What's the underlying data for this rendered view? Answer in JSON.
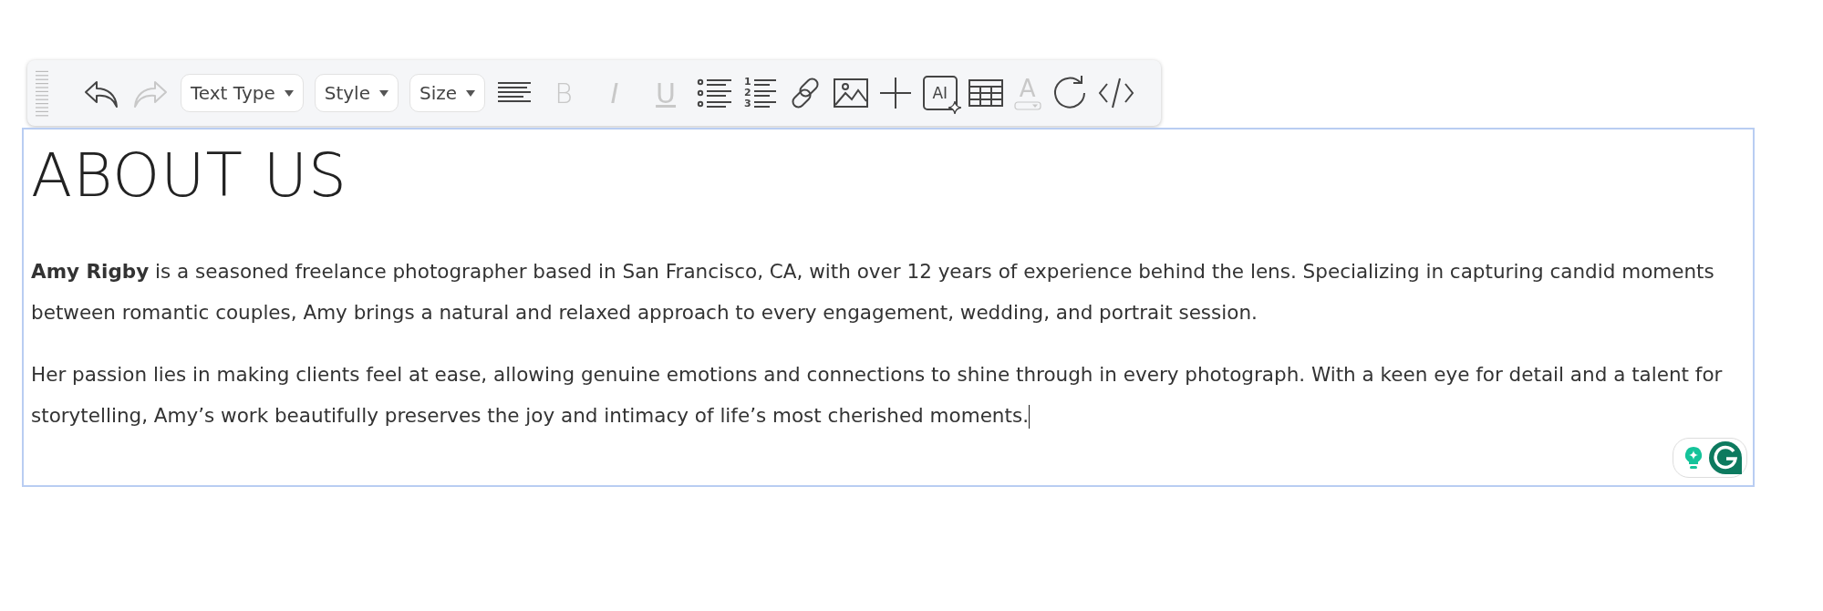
{
  "toolbar": {
    "undo": {
      "disabled": false
    },
    "redo": {
      "disabled": true
    },
    "dropdowns": [
      {
        "label": "Text Type"
      },
      {
        "label": "Style"
      },
      {
        "label": "Size"
      }
    ],
    "formats": [
      {
        "label": "B",
        "disabled": true
      },
      {
        "label": "I",
        "disabled": true
      },
      {
        "label": "U",
        "disabled": true
      }
    ],
    "numbered_list": {
      "marks": [
        "1",
        "2",
        "3"
      ]
    },
    "ai_button": {
      "label": "AI"
    },
    "text_color": {
      "label": "A",
      "disabled": true
    }
  },
  "editor": {
    "heading": "ABOUT US",
    "paragraphs": [
      "**Amy Rigby** is a seasoned freelance photographer based in San Francisco, CA, with over 12 years of experience behind the lens. Specializing in capturing candid moments between romantic couples, Amy brings a natural and relaxed approach to every engagement, wedding, and portrait session.",
      "Her passion lies in making clients feel at ease, allowing genuine emotions and connections to shine through in every photograph. With a keen eye for detail and a talent for storytelling, Amy’s work beautifully preserves the joy and intimacy of life’s most cherished moments."
    ]
  }
}
